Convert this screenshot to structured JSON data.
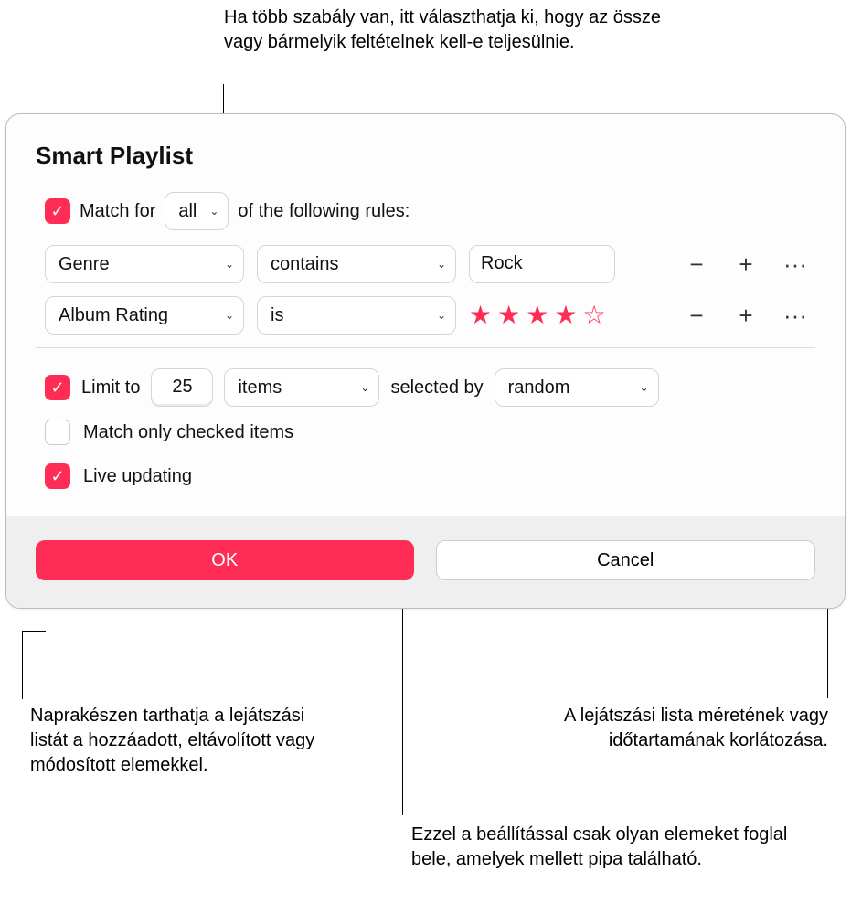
{
  "annotations": {
    "top": "Ha több szabály van, itt választhatja ki, hogy az össze vagy bármelyik feltételnek kell-e teljesülnie.",
    "bottom_left": "Naprakészen tarthatja a lejátszási listát a hozzáadott, eltávolított vagy módosított elemekkel.",
    "bottom_right": "A lejátszási lista méretének vagy időtartamának korlátozása.",
    "bottom_center": "Ezzel a beállítással csak olyan elemeket foglal bele, amelyek mellett pipa található."
  },
  "dialog": {
    "title": "Smart Playlist",
    "match": {
      "checked": true,
      "prefix": "Match for",
      "mode": "all",
      "suffix": "of the following rules:"
    },
    "rules": [
      {
        "field": "Genre",
        "operator": "contains",
        "value_type": "text",
        "value": "Rock"
      },
      {
        "field": "Album Rating",
        "operator": "is",
        "value_type": "stars",
        "stars_filled": 4,
        "stars_total": 5
      }
    ],
    "limit": {
      "checked": true,
      "prefix": "Limit to",
      "count": "25",
      "unit": "items",
      "selected_by_label": "selected by",
      "selected_by": "random"
    },
    "match_only_checked": {
      "checked": false,
      "label": "Match only checked items"
    },
    "live_updating": {
      "checked": true,
      "label": "Live updating"
    },
    "buttons": {
      "ok": "OK",
      "cancel": "Cancel"
    },
    "icons": {
      "minus": "−",
      "plus": "+",
      "more": "···",
      "check": "✓",
      "chevron": "⌄",
      "star_filled": "★",
      "star_empty": "☆"
    }
  }
}
